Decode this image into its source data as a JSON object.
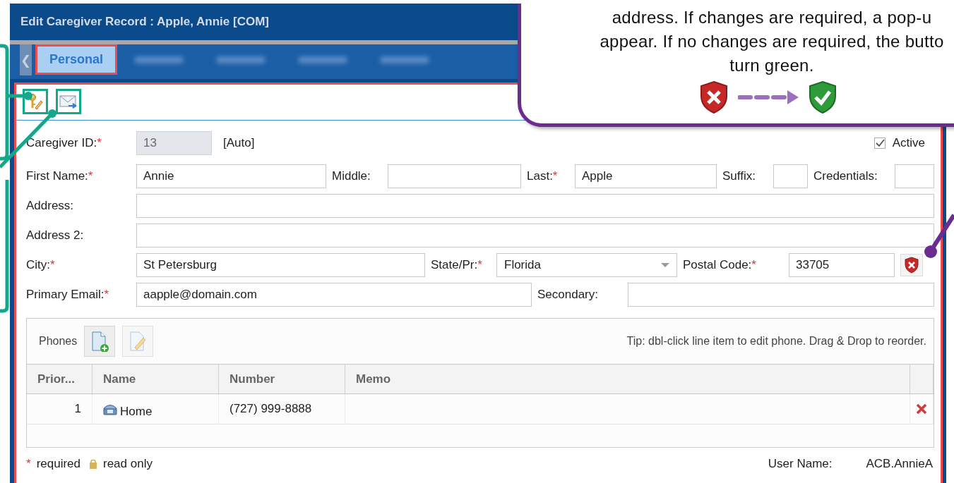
{
  "window": {
    "title": "Edit Caregiver Record : Apple, Annie [COM]"
  },
  "tabs": {
    "scroll_left": "❮",
    "items": [
      {
        "label": "Personal",
        "selected": true
      },
      {
        "selected": false
      },
      {
        "selected": false
      },
      {
        "selected": false
      },
      {
        "selected": false
      }
    ]
  },
  "form": {
    "rows": [
      {
        "items": [
          {
            "kind": "label",
            "text": "Caregiver ID:",
            "required_mark": "*"
          },
          {
            "kind": "field",
            "value": "13",
            "disabled": true
          },
          {
            "kind": "text",
            "text": "[Auto]"
          },
          {
            "kind": "checkbox",
            "label": "Active",
            "checked": true
          }
        ]
      },
      {
        "items": [
          {
            "kind": "label",
            "text": "First Name:",
            "required_mark": "*"
          },
          {
            "kind": "field",
            "value": "Annie",
            "disabled": false
          },
          {
            "kind": "label",
            "text": "Middle:"
          },
          {
            "kind": "field",
            "disabled": false
          },
          {
            "kind": "label",
            "text": "Last:",
            "required_mark": "*"
          },
          {
            "kind": "field",
            "value": "Apple",
            "disabled": false
          },
          {
            "kind": "label",
            "text": "Suffix:"
          },
          {
            "kind": "field",
            "disabled": false
          },
          {
            "kind": "label",
            "text": "Credentials:"
          },
          {
            "kind": "field",
            "disabled": false
          }
        ]
      },
      {
        "items": [
          {
            "kind": "label",
            "text": "Address:"
          },
          {
            "kind": "field",
            "disabled": false
          }
        ]
      },
      {
        "items": [
          {
            "kind": "label",
            "text": "Address 2:"
          },
          {
            "kind": "field",
            "disabled": false
          }
        ]
      },
      {
        "items": [
          {
            "kind": "label",
            "text": "City:",
            "required_mark": "*"
          },
          {
            "kind": "field",
            "value": "St Petersburg",
            "disabled": false
          },
          {
            "kind": "label",
            "text": "State/Pr:",
            "required_mark": "*"
          },
          {
            "kind": "select",
            "value": "Florida"
          },
          {
            "kind": "label",
            "text": "Postal Code:",
            "required_mark": "*"
          },
          {
            "kind": "field",
            "value": "33705",
            "disabled": false
          },
          {
            "kind": "validate",
            "error": true
          }
        ]
      },
      {
        "items": [
          {
            "kind": "label",
            "text": "Primary Email:",
            "required_mark": "*"
          },
          {
            "kind": "field",
            "value": "aapple@domain.com",
            "disabled": false
          },
          {
            "kind": "label",
            "text": "Secondary:"
          },
          {
            "kind": "field",
            "disabled": false
          }
        ]
      }
    ]
  },
  "phones": {
    "title": "Phones",
    "buttons": [
      {
        "kind": "add",
        "disabled": false
      },
      {
        "kind": "edit",
        "disabled": true
      }
    ],
    "tip": "Tip: dbl-click line item to edit phone. Drag & Drop to reorder.",
    "columns": [
      "Prior...",
      "Name",
      "Number",
      "Memo"
    ],
    "rows": [
      {
        "priority": "1",
        "name": "Home",
        "number": "(727) 999-8888"
      }
    ]
  },
  "legend": {
    "required_mark": "*",
    "required": "required",
    "read_only": "read only"
  },
  "user": {
    "label": "User Name:",
    "value": "ACB.AnnieA"
  },
  "callout": {
    "lines": [
      "address. If changes are required, a pop-u",
      "appear. If no changes are required, the butto",
      "turn green."
    ]
  }
}
